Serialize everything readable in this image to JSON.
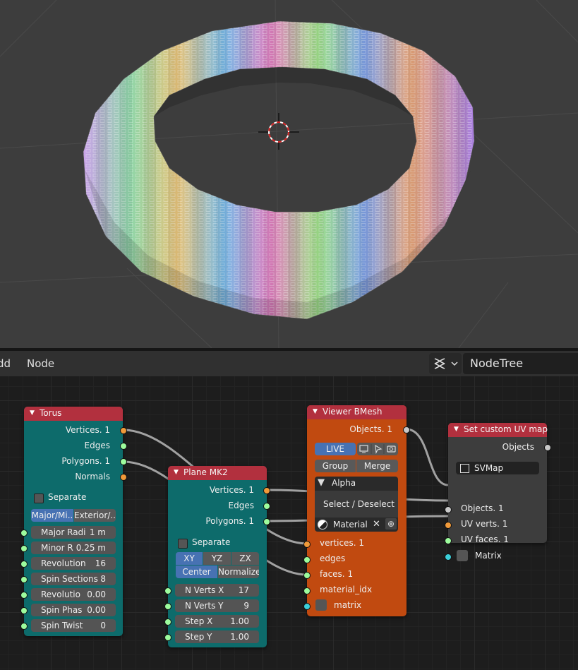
{
  "header": {
    "menu_add": "dd",
    "menu_node": "Node",
    "tree_name": "NodeTree"
  },
  "colors": {
    "socket_vertices": "#9dfc9d",
    "socket_object": "#f09a3a",
    "socket_matrix": "#3ccfd9",
    "node_header": "#b2303e",
    "torus_body": "#0d6b6b",
    "viewer_body": "#c14a10"
  },
  "torus": {
    "title": "Torus",
    "outputs": [
      "Vertices. 1",
      "Edges",
      "Polygons. 1",
      "Normals"
    ],
    "separate": "Separate",
    "mode_left": "Major/Mi..",
    "mode_right": "Exterior/..",
    "fields": [
      {
        "label": "Major Radi",
        "value": "1 m"
      },
      {
        "label": "Minor R",
        "value": "0.25 m"
      },
      {
        "label": "Revolution",
        "value": "16"
      },
      {
        "label": "Spin Sections",
        "value": "8"
      },
      {
        "label": "Revolutio",
        "value": "0.00"
      },
      {
        "label": "Spin Phas",
        "value": "0.00"
      },
      {
        "label": "Spin Twist",
        "value": "0"
      }
    ]
  },
  "plane": {
    "title": "Plane MK2",
    "outputs": [
      "Vertices. 1",
      "Edges",
      "Polygons. 1"
    ],
    "separate": "Separate",
    "axis": [
      "XY",
      "YZ",
      "ZX"
    ],
    "center": "Center",
    "normalize": "Normalize",
    "fields": [
      {
        "label": "N Verts X",
        "value": "17"
      },
      {
        "label": "N Verts Y",
        "value": "9"
      },
      {
        "label": "Step X",
        "value": "1.00"
      },
      {
        "label": "Step Y",
        "value": "1.00"
      }
    ]
  },
  "viewer": {
    "title": "Viewer BMesh",
    "output": "Objects. 1",
    "live": "LIVE",
    "group": "Group",
    "merge": "Merge",
    "alpha": "Alpha",
    "select": "Select / Deselect",
    "material": "Material",
    "inputs": [
      "vertices. 1",
      "edges",
      "faces. 1",
      "material_idx",
      "matrix"
    ]
  },
  "uvmap": {
    "title": "Set custom UV map",
    "output": "Objects",
    "map_name": "SVMap",
    "inputs": [
      "Objects. 1",
      "UV verts. 1",
      "UV faces. 1",
      "Matrix"
    ]
  }
}
